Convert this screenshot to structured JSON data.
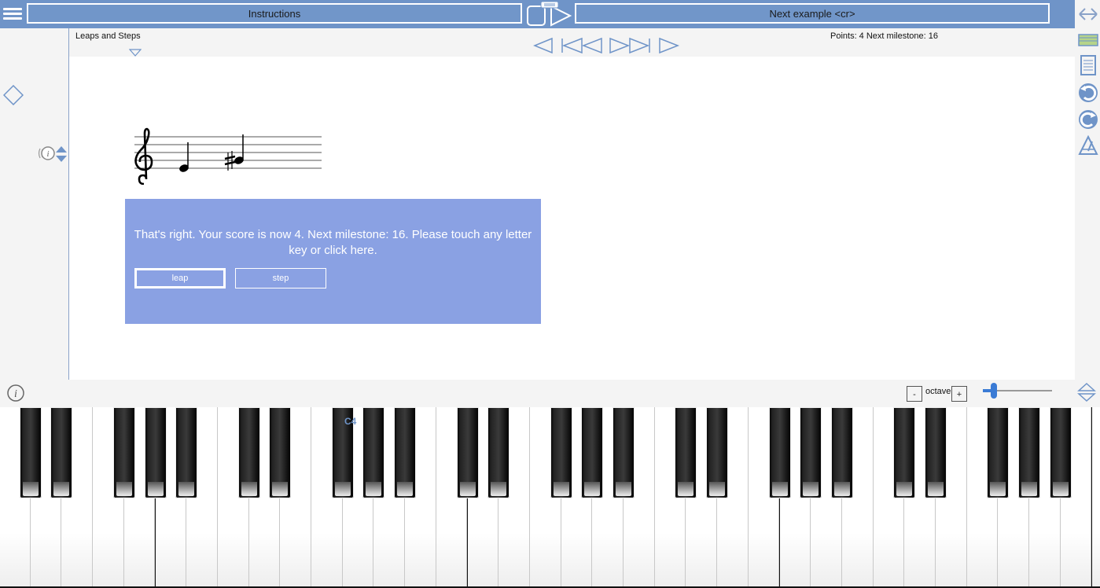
{
  "topbar": {
    "instructions_label": "Instructions",
    "next_label": "Next example <cr>"
  },
  "lesson": {
    "title": "Leaps and Steps",
    "points_text": "Points: 4 Next milestone: 16"
  },
  "feedback": {
    "message": "That's right. Your score is now 4. Next milestone: 16. Please touch any letter key or click here.",
    "answers": [
      "leap",
      "step"
    ]
  },
  "keyboard_toolbar": {
    "octave_down": "-",
    "octave_label": "octave",
    "octave_up": "+"
  },
  "keyboard": {
    "middle_c_label": "C4"
  },
  "colors": {
    "accent": "#6f94c8",
    "feedback_bg": "#8aa1e3"
  }
}
